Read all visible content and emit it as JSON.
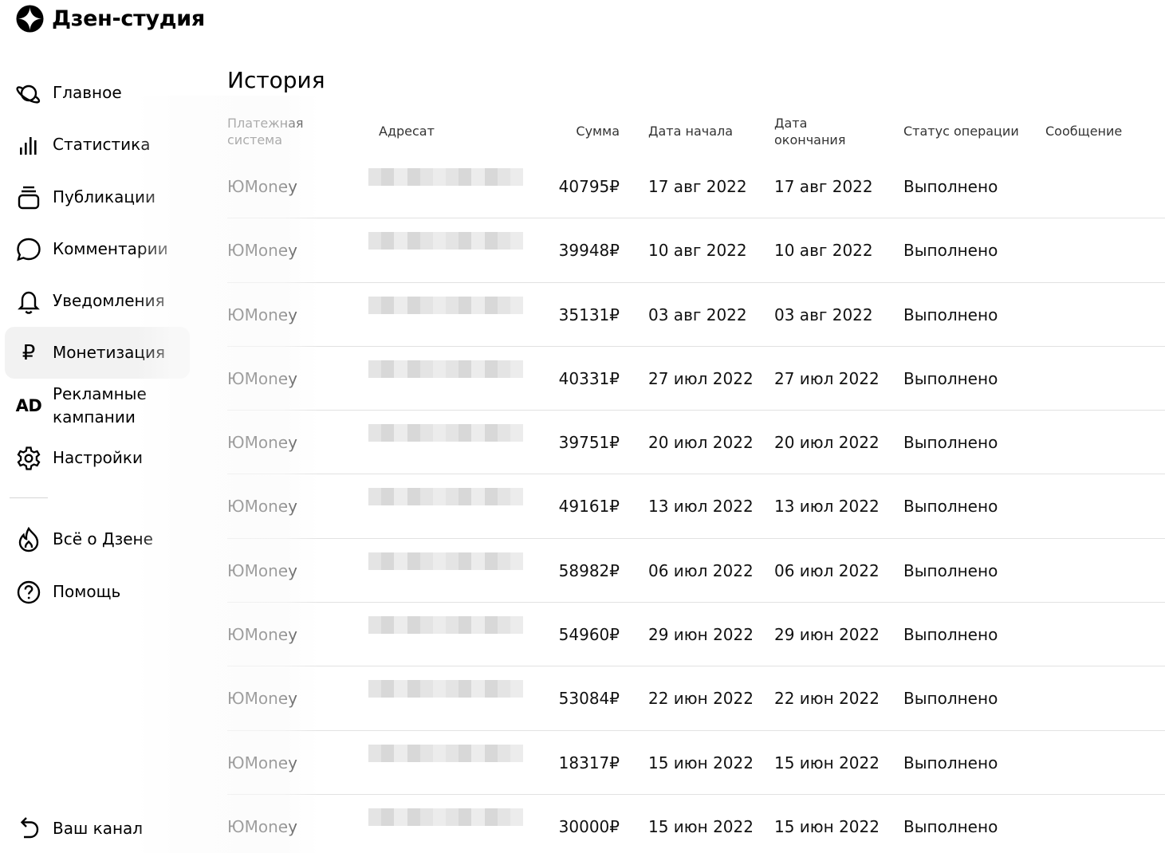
{
  "brand": {
    "name": "Дзен-студия"
  },
  "sidebar": {
    "items": [
      {
        "label": "Главное",
        "icon": "planet-icon"
      },
      {
        "label": "Статистика",
        "icon": "bar-chart-icon"
      },
      {
        "label": "Публикации",
        "icon": "publications-icon"
      },
      {
        "label": "Комментарии",
        "icon": "comment-icon"
      },
      {
        "label": "Уведомления",
        "icon": "bell-icon"
      },
      {
        "label": "Монетизация",
        "icon": "ruble-icon",
        "active": true
      },
      {
        "label": "Рекламные кампании",
        "icon": "ad-icon"
      },
      {
        "label": "Настройки",
        "icon": "gear-icon"
      }
    ],
    "secondary": [
      {
        "label": "Всё о Дзене",
        "icon": "flame-icon"
      },
      {
        "label": "Помощь",
        "icon": "help-icon"
      }
    ],
    "channel_label": "Ваш канал",
    "glyphs": {
      "ad": "AD",
      "ruble": "₽"
    }
  },
  "history": {
    "title": "История",
    "columns": {
      "system": "Платежная система",
      "recipient": "Адресат",
      "amount": "Сумма",
      "start": "Дата начала",
      "end": "Дата окончания",
      "status": "Статус операции",
      "message": "Сообщение"
    },
    "rows": [
      {
        "system": "ЮMoney",
        "amount": "40795₽",
        "start": "17 авг 2022",
        "end": "17 авг 2022",
        "status": "Выполнено",
        "message": ""
      },
      {
        "system": "ЮMoney",
        "amount": "39948₽",
        "start": "10 авг 2022",
        "end": "10 авг 2022",
        "status": "Выполнено",
        "message": ""
      },
      {
        "system": "ЮMoney",
        "amount": "35131₽",
        "start": "03 авг 2022",
        "end": "03 авг 2022",
        "status": "Выполнено",
        "message": ""
      },
      {
        "system": "ЮMoney",
        "amount": "40331₽",
        "start": "27 июл 2022",
        "end": "27 июл 2022",
        "status": "Выполнено",
        "message": ""
      },
      {
        "system": "ЮMoney",
        "amount": "39751₽",
        "start": "20 июл 2022",
        "end": "20 июл 2022",
        "status": "Выполнено",
        "message": ""
      },
      {
        "system": "ЮMoney",
        "amount": "49161₽",
        "start": "13 июл 2022",
        "end": "13 июл 2022",
        "status": "Выполнено",
        "message": ""
      },
      {
        "system": "ЮMoney",
        "amount": "58982₽",
        "start": "06 июл 2022",
        "end": "06 июл 2022",
        "status": "Выполнено",
        "message": ""
      },
      {
        "system": "ЮMoney",
        "amount": "54960₽",
        "start": "29 июн 2022",
        "end": "29 июн 2022",
        "status": "Выполнено",
        "message": ""
      },
      {
        "system": "ЮMoney",
        "amount": "53084₽",
        "start": "22 июн 2022",
        "end": "22 июн 2022",
        "status": "Выполнено",
        "message": ""
      },
      {
        "system": "ЮMoney",
        "amount": "18317₽",
        "start": "15 июн 2022",
        "end": "15 июн 2022",
        "status": "Выполнено",
        "message": ""
      },
      {
        "system": "ЮMoney",
        "amount": "30000₽",
        "start": "15 июн 2022",
        "end": "15 июн 2022",
        "status": "Выполнено",
        "message": ""
      }
    ]
  }
}
